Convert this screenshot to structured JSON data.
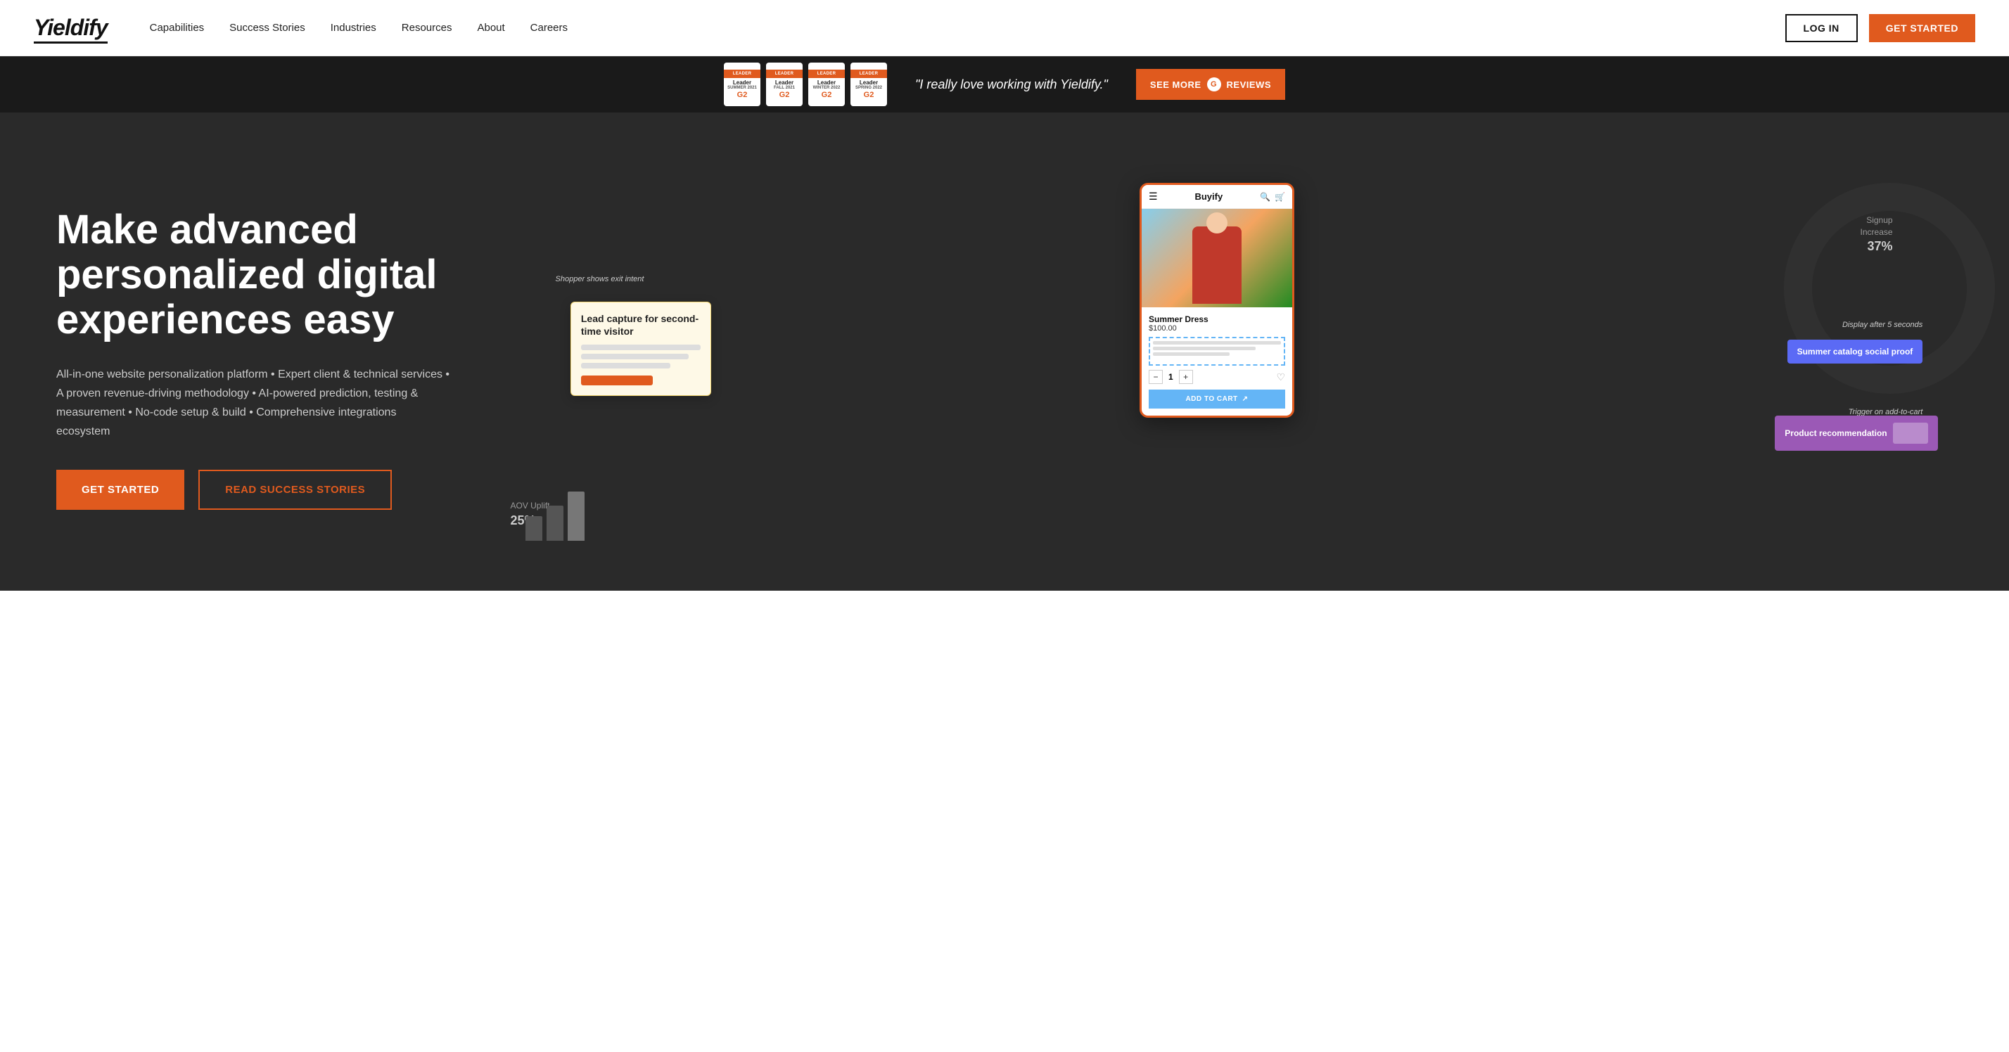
{
  "navbar": {
    "logo": "Yieldify",
    "links": [
      {
        "label": "Capabilities",
        "id": "capabilities"
      },
      {
        "label": "Success Stories",
        "id": "success-stories"
      },
      {
        "label": "Industries",
        "id": "industries"
      },
      {
        "label": "Resources",
        "id": "resources"
      },
      {
        "label": "About",
        "id": "about"
      },
      {
        "label": "Careers",
        "id": "careers"
      }
    ],
    "login_label": "LOG IN",
    "get_started_label": "GET STARTED"
  },
  "banner": {
    "quote": "\"I really love working with Yieldify.\"",
    "see_more_label": "SEE MORE",
    "reviews_label": "REVIEWS",
    "badges": [
      {
        "top": "G2",
        "season": "SUMMER",
        "year": "2021",
        "label": "Leader"
      },
      {
        "top": "G2",
        "season": "FALL",
        "year": "2021",
        "label": "Leader"
      },
      {
        "top": "G2",
        "season": "WINTER",
        "year": "2022",
        "label": "Leader"
      },
      {
        "top": "G2",
        "season": "SPRING",
        "year": "2022",
        "label": "Leader"
      }
    ]
  },
  "hero": {
    "title": "Make advanced personalized digital experiences easy",
    "description": "All-in-one website personalization platform • Expert client & technical services • A proven revenue-driving methodology • AI-powered prediction, testing & measurement • No-code setup & build • Comprehensive integrations ecosystem",
    "get_started_label": "GET STARTED",
    "read_stories_label": "READ SUCCESS STORIES"
  },
  "hero_visual": {
    "phone": {
      "brand": "Buyify",
      "product_name": "Summer Dress",
      "product_price": "$100.00",
      "add_to_cart": "ADD TO CART",
      "qty": "1"
    },
    "lead_popup": {
      "title": "Lead capture for second-time visitor"
    },
    "tags": {
      "exit_intent": "Shopper shows exit intent",
      "display_after": "Display after 5 seconds",
      "trigger": "Trigger on add-to-cart"
    },
    "social_proof": "Summer catalog social proof",
    "product_rec": "Product recommendation",
    "stats": {
      "signup_label": "Signup\nIncrease",
      "signup_value": "37%",
      "aov_label": "AOV Uplift",
      "aov_value": "25%"
    }
  }
}
